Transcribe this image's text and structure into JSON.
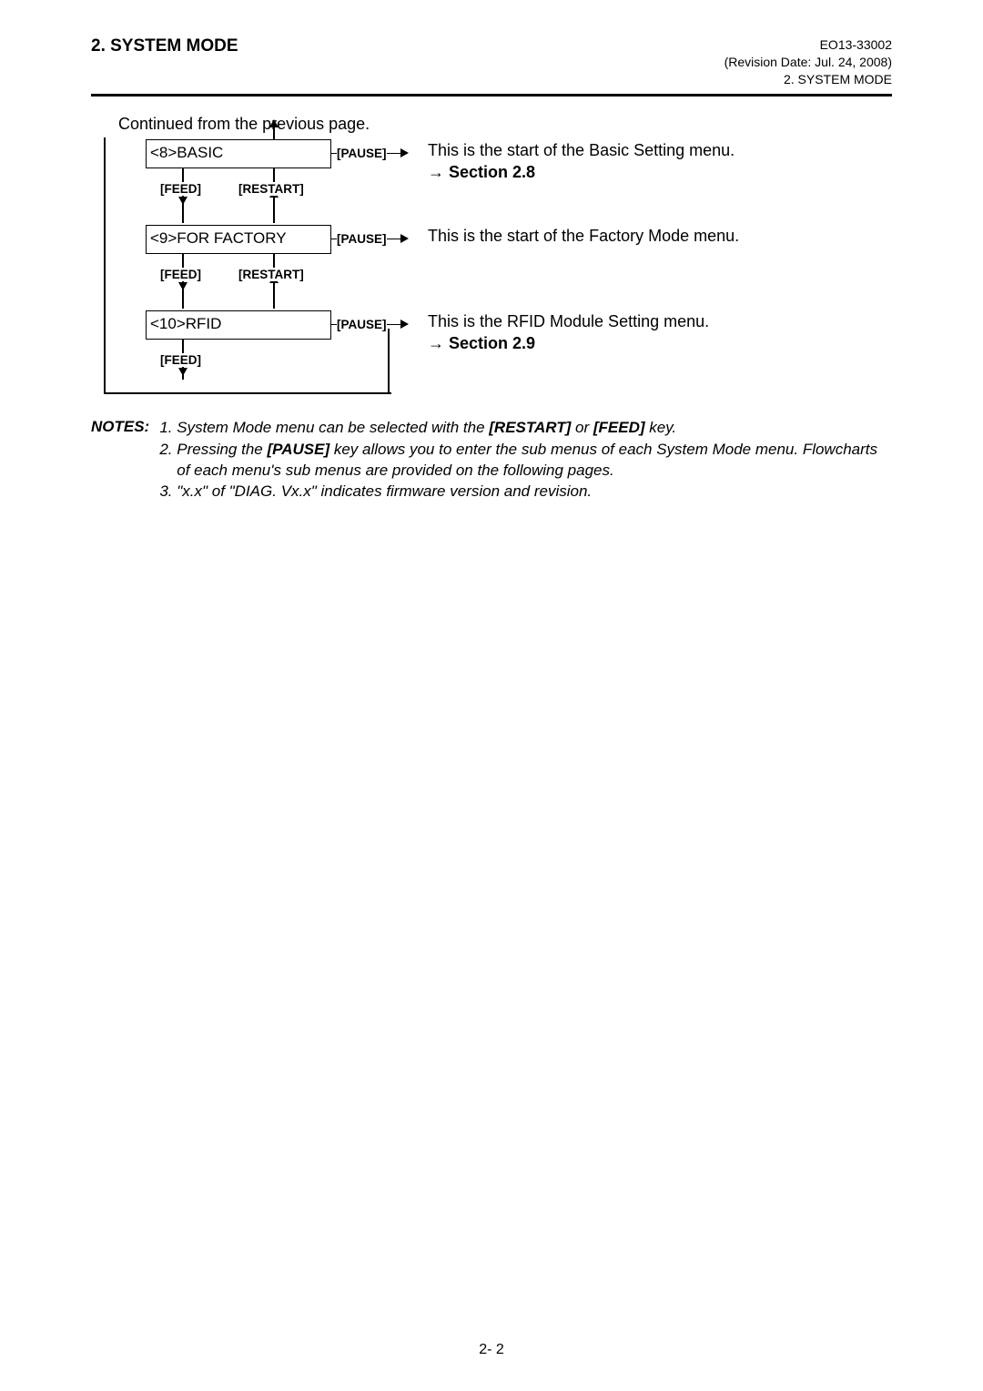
{
  "header": {
    "left": "2. SYSTEM MODE",
    "eo": "EO13-33002",
    "rev": "(Revision Date: Jul. 24, 2008)",
    "section": "2. SYSTEM MODE"
  },
  "continued": "Continued from the previous page.",
  "keys": {
    "feed": "[FEED]",
    "restart": "[RESTART]",
    "pause": "[PAUSE]"
  },
  "steps": [
    {
      "box": "<8>BASIC",
      "desc": "This is the start of the Basic Setting menu.",
      "sectionRef": "Section 2.8",
      "showRestart": true,
      "showDown": true,
      "showSection": true
    },
    {
      "box": "<9>FOR FACTORY",
      "desc": "This is the start of the Factory Mode menu.",
      "sectionRef": "",
      "showRestart": true,
      "showDown": true,
      "showSection": false
    },
    {
      "box": "<10>RFID",
      "desc": "This is the RFID Module Setting menu.",
      "sectionRef": "Section 2.9",
      "showRestart": false,
      "showDown": true,
      "showSection": true
    }
  ],
  "notesLabel": "NOTES:",
  "notes": [
    {
      "pre": "System Mode menu can be selected with the ",
      "k1": "[RESTART]",
      "mid": " or ",
      "k2": "[FEED]",
      "post": " key."
    },
    {
      "pre": "Pressing the ",
      "k1": "[PAUSE]",
      "mid": " key allows you to enter the sub menus of each System Mode menu.  Flowcharts of each menu's sub menus are provided on the following pages.",
      "k2": "",
      "post": ""
    },
    {
      "pre": "\"x.x\" of \"DIAG. Vx.x\" indicates firmware version and revision.",
      "k1": "",
      "mid": "",
      "k2": "",
      "post": ""
    }
  ],
  "footer": "2- 2"
}
